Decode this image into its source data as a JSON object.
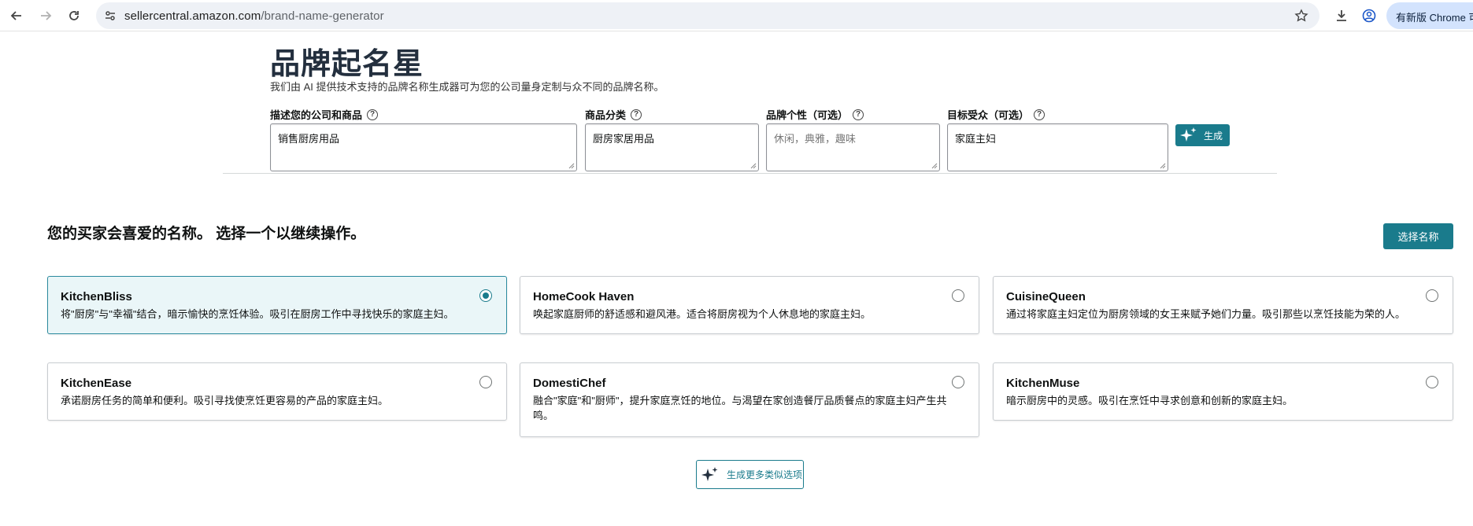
{
  "browser": {
    "url_domain": "sellercentral.amazon.com",
    "url_path": "/brand-name-generator",
    "update_label": "有新版 Chrome 可"
  },
  "header": {
    "title": "品牌起名星",
    "subtitle": "我们由 AI 提供技术支持的品牌名称生成器可为您的公司量身定制与众不同的品牌名称。"
  },
  "form": {
    "fields": [
      {
        "label": "描述您的公司和商品",
        "value": "销售厨房用品",
        "placeholder": ""
      },
      {
        "label": "商品分类",
        "value": "厨房家居用品",
        "placeholder": ""
      },
      {
        "label": "品牌个性（可选）",
        "value": "",
        "placeholder": "休闲，典雅，趣味"
      },
      {
        "label": "目标受众（可选）",
        "value": "家庭主妇",
        "placeholder": ""
      }
    ],
    "help_glyph": "?",
    "generate_label": "生成"
  },
  "results": {
    "heading": "您的买家会喜爱的名称。 选择一个以继续操作。",
    "choose_label": "选择名称",
    "selected_index": 0,
    "cards": [
      {
        "name": "KitchenBliss",
        "desc": "将\"厨房\"与\"幸福\"结合，暗示愉快的烹饪体验。吸引在厨房工作中寻找快乐的家庭主妇。",
        "selected": true
      },
      {
        "name": "HomeCook Haven",
        "desc": "唤起家庭厨师的舒适感和避风港。适合将厨房视为个人休息地的家庭主妇。",
        "selected": false
      },
      {
        "name": "CuisineQueen",
        "desc": "通过将家庭主妇定位为厨房领域的女王来赋予她们力量。吸引那些以烹饪技能为荣的人。",
        "selected": false
      },
      {
        "name": "KitchenEase",
        "desc": "承诺厨房任务的简单和便利。吸引寻找使烹饪更容易的产品的家庭主妇。",
        "selected": false
      },
      {
        "name": "DomestiChef",
        "desc": "融合\"家庭\"和\"厨师\"，提升家庭烹饪的地位。与渴望在家创造餐厅品质餐点的家庭主妇产生共鸣。",
        "selected": false
      },
      {
        "name": "KitchenMuse",
        "desc": "暗示厨房中的灵感。吸引在烹饪中寻求创意和创新的家庭主妇。",
        "selected": false
      }
    ],
    "more_label": "生成更多类似选项"
  },
  "colors": {
    "accent": "#1a7b8c",
    "selected_bg": "#eaf6f8"
  }
}
